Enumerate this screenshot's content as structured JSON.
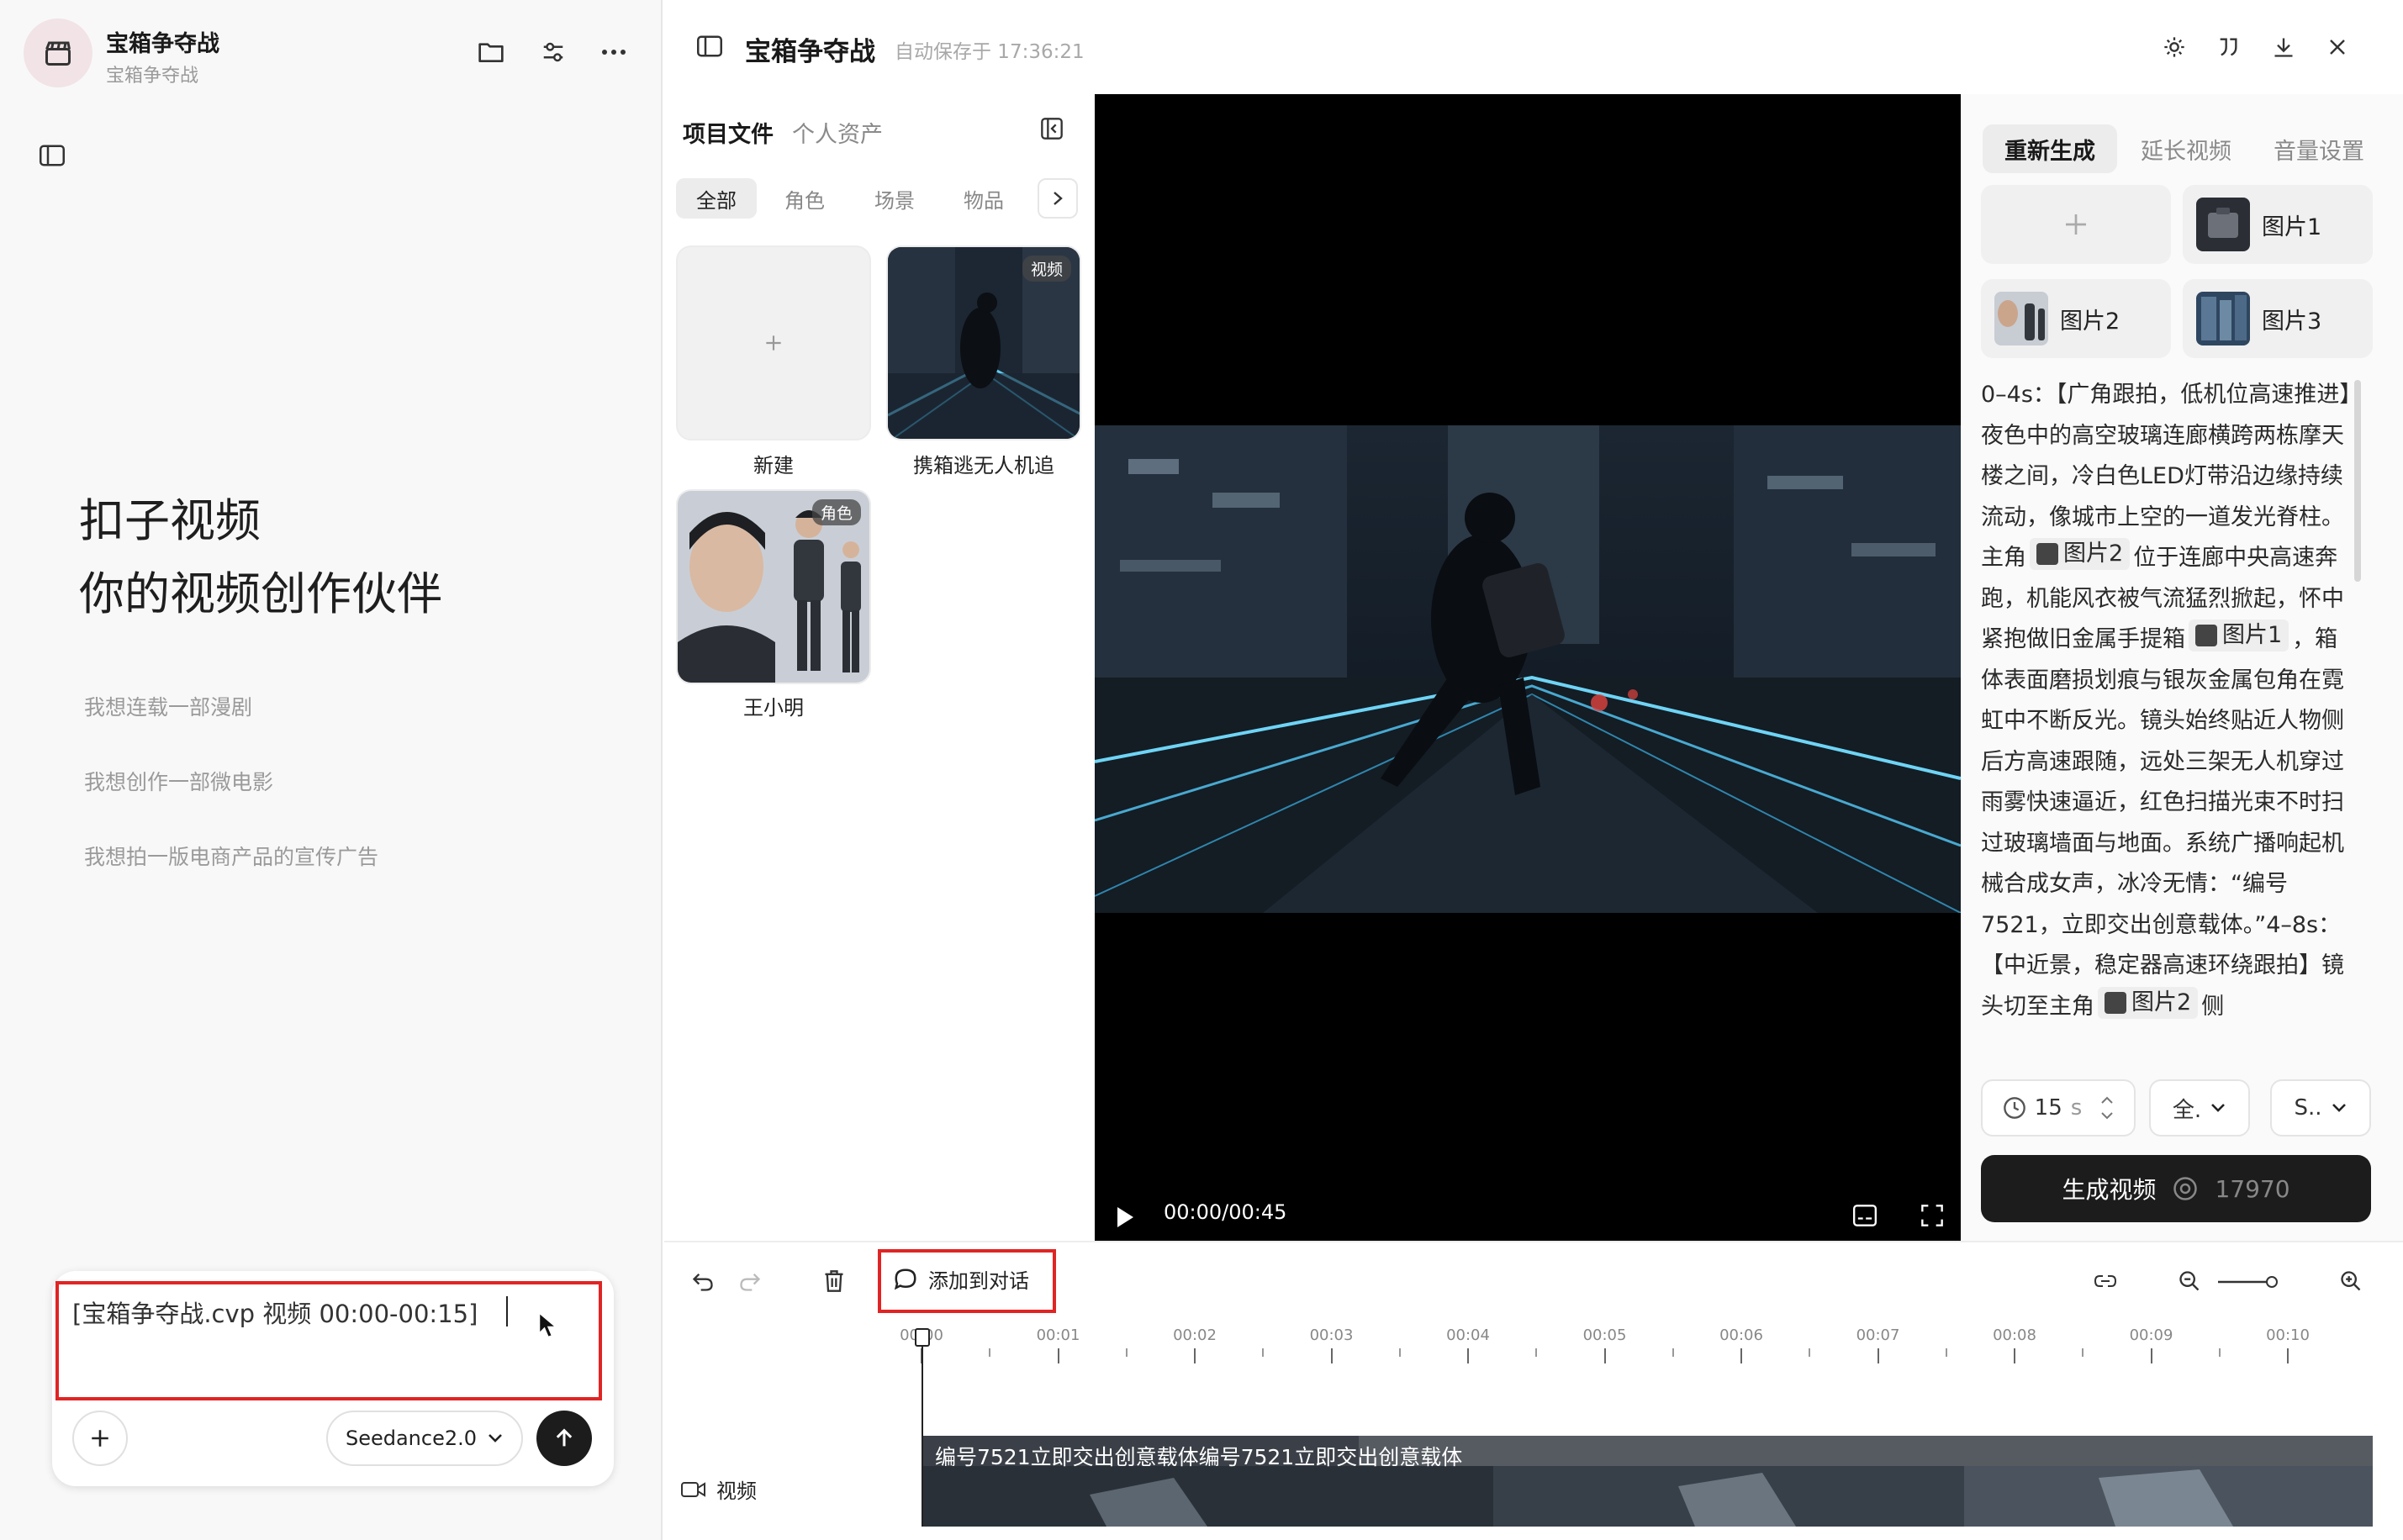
{
  "chat": {
    "project_title": "宝箱争夺战",
    "project_subtitle": "宝箱争夺战",
    "hero_line1": "扣子视频",
    "hero_line2": "你的视频创作伙伴",
    "suggestions": [
      "我想连载一部漫剧",
      "我想创作一部微电影",
      "我想拍一版电商产品的宣传广告"
    ],
    "input_value": "[宝箱争夺战.cvp 视频 00:00-00:15]",
    "model": "Seedance2.0"
  },
  "topbar": {
    "title": "宝箱争夺战",
    "autosave": "自动保存于 17:36:21"
  },
  "assets": {
    "tabs": [
      "项目文件",
      "个人资产"
    ],
    "filters": [
      "全部",
      "角色",
      "场景",
      "物品"
    ],
    "items": [
      {
        "label": "新建"
      },
      {
        "label": "携箱逃无人机追",
        "badge": "视频"
      },
      {
        "label": "王小明",
        "badge": "角色"
      }
    ]
  },
  "video": {
    "time": "00:00/00:45"
  },
  "generate": {
    "tabs": [
      "重新生成",
      "延长视频",
      "音量设置"
    ],
    "images": [
      "图片1",
      "图片2",
      "图片3"
    ],
    "prompt": {
      "p1": "0–4s：【广角跟拍，低机位高速推进】夜色中的高空玻璃连廊横跨两栋摩天楼之间，冷白色LED灯带沿边缘持续流动，像城市上空的一道发光脊柱。主角",
      "ref1": "图片2",
      "p2": "位于连廊中央高速奔跑，机能风衣被气流猛烈掀起，怀中紧抱做旧金属手提箱",
      "ref2": "图片1",
      "p3": "，箱体表面磨损划痕与银灰金属包角在霓虹中不断反光。镜头始终贴近人物侧后方高速跟随，远处三架无人机穿过雨雾快速逼近，红色扫描光束不时扫过玻璃墙面与地面。系统广播响起机械合成女声，冰冷无情：“编号7521，立即交出创意载体。”4–8s：【中近景，稳定器高速环绕跟拍】镜头切至主角",
      "ref3": "图片2",
      "p4": "侧"
    },
    "duration_value": "15",
    "duration_unit": "s",
    "option1": "全.",
    "option2": "S..",
    "button_label": "生成视频",
    "cost": "17970"
  },
  "timeline": {
    "add_to_chat": "添加到对话",
    "ticks": [
      "00:00",
      "00:01",
      "00:02",
      "00:03",
      "00:04",
      "00:05",
      "00:06",
      "00:07",
      "00:08",
      "00:09",
      "00:10"
    ],
    "track_label": "视频",
    "clip_caption": "编号7521立即交出创意载体编号7521立即交出创意载体"
  }
}
